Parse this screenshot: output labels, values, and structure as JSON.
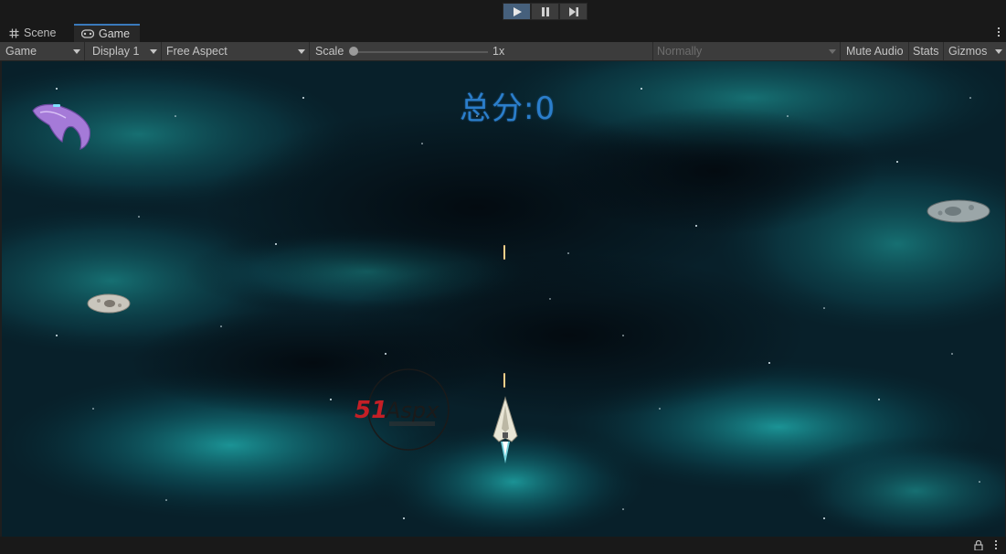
{
  "window": {
    "tabs": [
      {
        "label": "Scene",
        "icon": "grid-icon"
      },
      {
        "label": "Game",
        "icon": "gamepad-icon"
      }
    ]
  },
  "playbar": {
    "buttons": [
      {
        "name": "play",
        "icon": "play-icon",
        "active": true
      },
      {
        "name": "pause",
        "icon": "pause-icon",
        "active": false
      },
      {
        "name": "step",
        "icon": "step-icon",
        "active": false
      }
    ]
  },
  "toolbar": {
    "view_select": "Game",
    "display_select": "Display 1",
    "aspect_select": "Free Aspect",
    "scale_label": "Scale",
    "scale_value": "1x",
    "scale_fraction": 0,
    "play_focus_select": "Normally",
    "mute_audio": "Mute Audio",
    "stats": "Stats",
    "gizmos": "Gizmos"
  },
  "game": {
    "score_text": "总分:0",
    "watermark": "51Aspx",
    "colors": {
      "score": "#2b7ecb",
      "accent": "#3a79bb"
    }
  }
}
